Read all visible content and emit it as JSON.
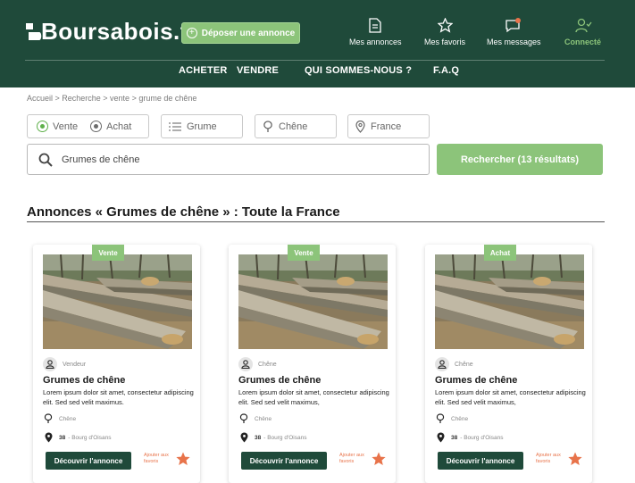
{
  "header": {
    "logo": "Boursabois.fr",
    "deposit_label": "Déposer une annonce",
    "nav": [
      {
        "label": "Mes annonces",
        "icon": "document-icon"
      },
      {
        "label": "Mes favoris",
        "icon": "star-outline-icon"
      },
      {
        "label": "Mes messages",
        "icon": "message-icon"
      },
      {
        "label": "Connecté",
        "icon": "user-check-icon"
      }
    ],
    "menu": [
      "ACHETER",
      "VENDRE",
      "QUI SOMMES-NOUS ?",
      "F.A.Q"
    ]
  },
  "breadcrumb": "Accueil > Recherche > vente > grume de chêne",
  "filters": {
    "radio_vente": "Vente",
    "radio_achat": "Achat",
    "selected": "Vente",
    "type": "Grume",
    "essence": "Chêne",
    "location": "France"
  },
  "search": {
    "value": "Grumes de chêne",
    "button_label": "Rechercher (13 résultats)"
  },
  "section_title": "Annonces « Grumes de chêne » : Toute la France",
  "cards": [
    {
      "tag": "Vente",
      "meta1": "Vendeur",
      "title": "Grumes de chêne",
      "description": "Lorem ipsum dolor sit amet, consectetur adipiscing elit. Sed sed velit maximus.",
      "essence": "Chêne",
      "dept": "38",
      "city": "- Bourg d'Oisans",
      "cta": "Découvrir l'annonce",
      "fav": "Ajouter aux favoris"
    },
    {
      "tag": "Vente",
      "meta1": "Chêne",
      "title": "Grumes de chêne",
      "description": "Lorem ipsum dolor sit amet, consectetur adipiscing elit. Sed sed velit maximus,",
      "essence": "Chêne",
      "dept": "38",
      "city": "- Bourg d'Oisans",
      "cta": "Découvrir l'annonce",
      "fav": "Ajouter aux favoris"
    },
    {
      "tag": "Achat",
      "meta1": "Chêne",
      "title": "Grumes de chêne",
      "description": "Lorem ipsum dolor sit amet, consectetur adipiscing elit. Sed sed velit maximus,",
      "essence": "Chêne",
      "dept": "38",
      "city": "- Bourg d'Oisans",
      "cta": "Découvrir l'annonce",
      "fav": "Ajouter aux favoris"
    }
  ],
  "colors": {
    "primary_dark": "#1f4a3a",
    "accent_green": "#8cc47a",
    "favorite_orange": "#e8734a"
  }
}
